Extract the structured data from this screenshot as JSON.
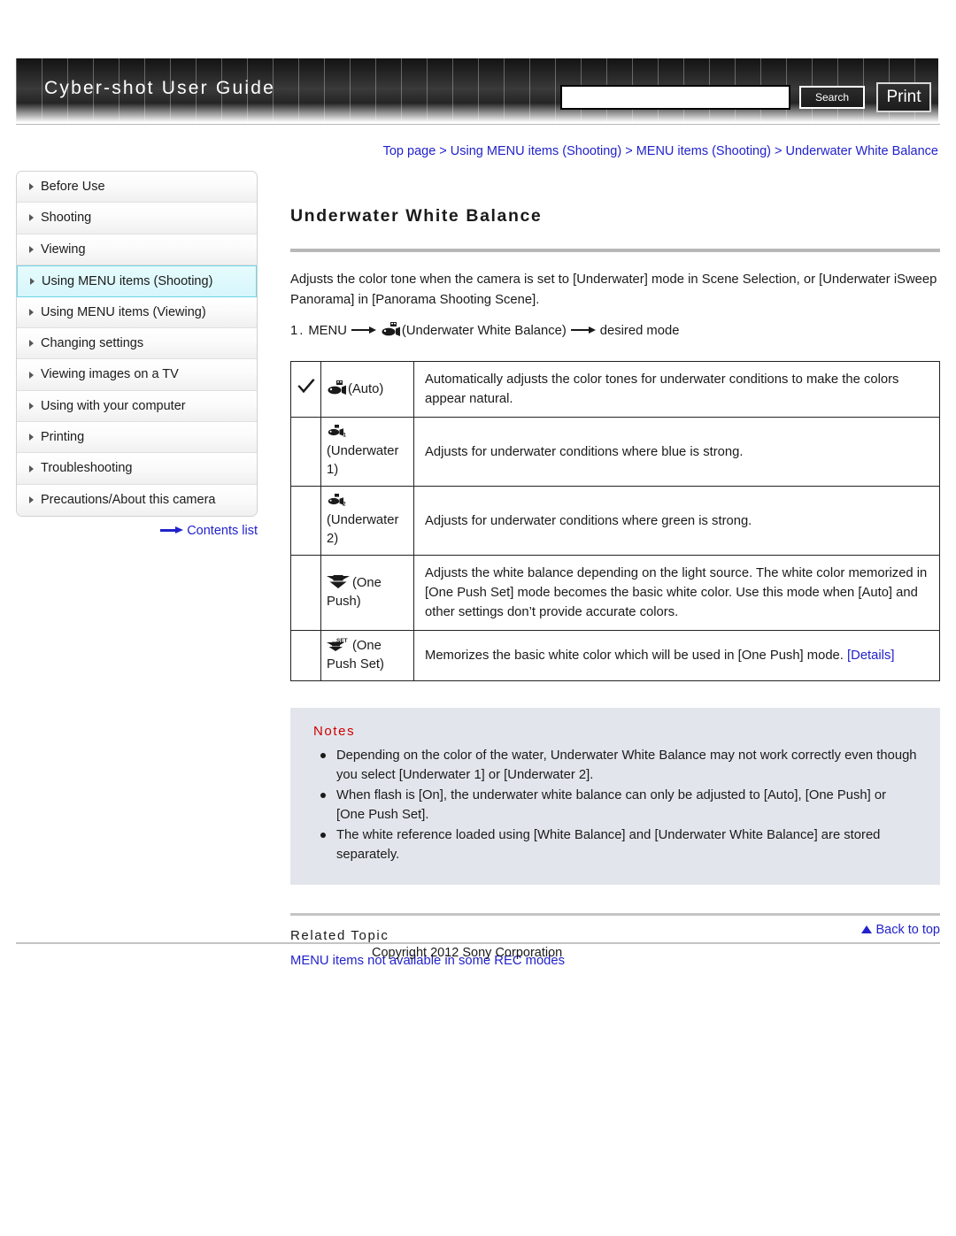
{
  "header": {
    "title": "Cyber-shot User Guide",
    "search_value": "",
    "search_placeholder": "",
    "search_button_label": "Search",
    "print_button_label": "Print"
  },
  "breadcrumb": {
    "text": "Top page > Using MENU items (Shooting) > MENU items (Shooting) > Underwater White Balance"
  },
  "sidebar": {
    "items": [
      {
        "label": "Before Use",
        "active": false
      },
      {
        "label": "Shooting",
        "active": false
      },
      {
        "label": "Viewing",
        "active": false
      },
      {
        "label": "Using MENU items (Shooting)",
        "active": true
      },
      {
        "label": "Using MENU items (Viewing)",
        "active": false
      },
      {
        "label": "Changing settings",
        "active": false
      },
      {
        "label": "Viewing images on a TV",
        "active": false
      },
      {
        "label": "Using with your computer",
        "active": false
      },
      {
        "label": "Printing",
        "active": false
      },
      {
        "label": "Troubleshooting",
        "active": false
      },
      {
        "label": "Precautions/About this camera",
        "active": false
      }
    ],
    "contents_list_label": "Contents list"
  },
  "main": {
    "page_title": "Underwater White Balance",
    "intro": "Adjusts the color tone when the camera is set to [Underwater] mode in Scene Selection, or [Underwater iSweep Panorama] in [Panorama Shooting Scene].",
    "step": {
      "number": "1.",
      "part1": "MENU",
      "part2": "(Underwater White Balance)",
      "part3": "desired mode"
    },
    "table": {
      "rows": [
        {
          "checked": true,
          "icon": "underwater-auto-icon",
          "label": "(Auto)",
          "description": "Automatically adjusts the color tones for underwater conditions to make the colors appear natural."
        },
        {
          "checked": false,
          "icon": "underwater-1-icon",
          "label": "(Underwater 1)",
          "description": "Adjusts for underwater conditions where blue is strong."
        },
        {
          "checked": false,
          "icon": "underwater-2-icon",
          "label": "(Underwater 2)",
          "description": "Adjusts for underwater conditions where green is strong."
        },
        {
          "checked": false,
          "icon": "one-push-icon",
          "label": "(One Push)",
          "description": "Adjusts the white balance depending on the light source. The white color memorized in [One Push Set] mode becomes the basic white color. Use this mode when [Auto] and other settings don’t provide accurate colors."
        },
        {
          "checked": false,
          "icon": "one-push-set-icon",
          "label": "(One Push Set)",
          "description": "Memorizes the basic white color which will be used in [One Push] mode.",
          "link_label": "[Details]"
        }
      ]
    },
    "notes": {
      "heading": "Notes",
      "items": [
        "Depending on the color of the water, Underwater White Balance may not work correctly even though you select [Underwater 1] or [Underwater 2].",
        "When flash is [On], the underwater white balance can only be adjusted to [Auto], [One Push] or [One Push Set].",
        "The white reference loaded using [White Balance] and [Underwater White Balance] are stored separately."
      ]
    },
    "related": {
      "heading": "Related Topic",
      "link_label": "MENU items not available in some REC modes"
    }
  },
  "footer": {
    "back_to_top_label": "Back to top",
    "copyright": "Copyright 2012 Sony Corporation"
  },
  "colors": {
    "link": "#2222cc",
    "notes_heading": "#cc0000",
    "notes_bg": "#e2e6ec",
    "active_nav_bg": "#d6f6fb",
    "active_nav_border": "#6fd4e6"
  }
}
